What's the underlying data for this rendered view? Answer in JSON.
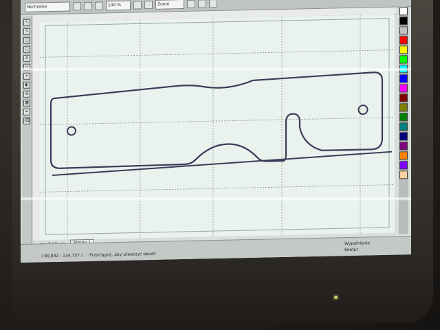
{
  "app": {
    "toolbar": {
      "font_field": "Normalne",
      "size_field": "100 %",
      "zoom_field": "Zoom"
    },
    "tools": [
      "↖",
      "✎",
      "□",
      "○",
      "A",
      "✂",
      "⌖",
      "◐",
      "✣",
      "▦",
      "✒",
      "⌫"
    ],
    "palette_colors": [
      "#ffffff",
      "#000000",
      "#c0c0c0",
      "#ff0000",
      "#ffff00",
      "#00ff00",
      "#00ffff",
      "#0000ff",
      "#ff00ff",
      "#800000",
      "#808000",
      "#008000",
      "#008080",
      "#000080",
      "#800080",
      "#ff8000",
      "#8000ff",
      "#ffd0a0"
    ],
    "page_tabs": {
      "counter": "1 / 1",
      "page_label": "Strona 1"
    },
    "status": {
      "coords": "( 90,932 ; 134,757 )",
      "message": "Przeciągnij, aby utworzyć obiekt",
      "right_line1": "Wypełnienie",
      "right_line2": "Kontur"
    }
  },
  "icons": {
    "pick_tool": "pointer-icon",
    "shape_tool": "shape-icon"
  }
}
